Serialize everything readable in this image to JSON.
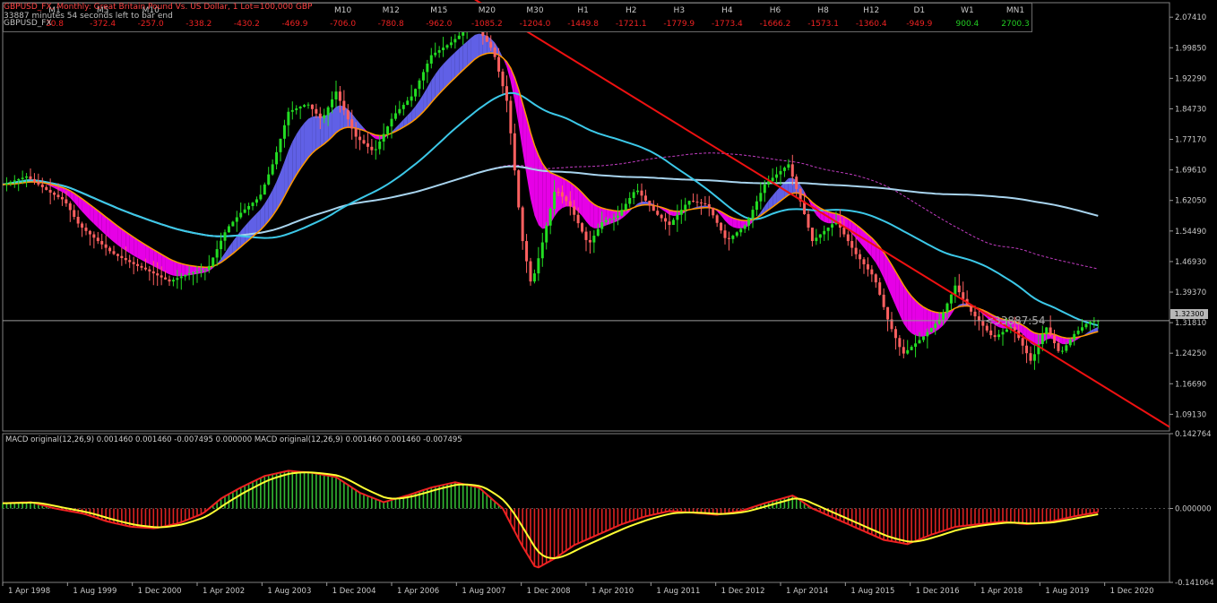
{
  "header": {
    "symbol_line": "GBPUSD_FX, Monthly:  Great Britain Pound Vs. US Dollar, 1 Lot=100,000 GBP",
    "timer_line": "33887 minutes 54 seconds left to bar end",
    "row_label": "GBPUSD_FX"
  },
  "timeframes": [
    {
      "label": "M1",
      "value": "30.8",
      "positive": false
    },
    {
      "label": "M5",
      "value": "-372.4",
      "positive": false
    },
    {
      "label": "M10",
      "value": "-257.0",
      "positive": false
    },
    {
      "label": "",
      "value": "-338.2",
      "positive": false
    },
    {
      "label": "",
      "value": "-430.2",
      "positive": false
    },
    {
      "label": "",
      "value": "-469.9",
      "positive": false
    },
    {
      "label": "M10",
      "value": "-706.0",
      "positive": false
    },
    {
      "label": "M12",
      "value": "-780.8",
      "positive": false
    },
    {
      "label": "M15",
      "value": "-962.0",
      "positive": false
    },
    {
      "label": "M20",
      "value": "-1085.2",
      "positive": false
    },
    {
      "label": "M30",
      "value": "-1204.0",
      "positive": false
    },
    {
      "label": "H1",
      "value": "-1449.8",
      "positive": false
    },
    {
      "label": "H2",
      "value": "-1721.1",
      "positive": false
    },
    {
      "label": "H3",
      "value": "-1779.9",
      "positive": false
    },
    {
      "label": "H4",
      "value": "-1773.4",
      "positive": false
    },
    {
      "label": "H6",
      "value": "-1666.2",
      "positive": false
    },
    {
      "label": "H8",
      "value": "-1573.1",
      "positive": false
    },
    {
      "label": "H12",
      "value": "-1360.4",
      "positive": false
    },
    {
      "label": "D1",
      "value": "-949.9",
      "positive": false
    },
    {
      "label": "W1",
      "value": "900.4",
      "positive": true
    },
    {
      "label": "MN1",
      "value": "2700.3",
      "positive": true
    }
  ],
  "current_price": "1.32300",
  "countdown": "<33887:54",
  "macd_label": "MACD original(12,26,9) 0.001460 0.001460 -0.007495 0.000000 MACD original(12,26,9) 0.001460 0.001460 -0.007495",
  "colors": {
    "background": "#000000",
    "up": "#22dd22",
    "down": "#ff6060",
    "ribbon_up": "#6a6aff",
    "ribbon_down": "#ff00ff",
    "ma_cyan": "#3cc8e8",
    "ma_lightblue": "#a8d4ee",
    "ma_purple": "#c23cc2",
    "ma_white": "#c8d0e0",
    "trendline": "#ee1111",
    "macd_signal": "#ffff33",
    "macd_line": "#ee2222"
  },
  "chart_data": [
    {
      "type": "line",
      "title": "GBPUSD_FX Monthly",
      "ylim": [
        1.05,
        2.11
      ],
      "y_ticks": [
        "2.07410",
        "1.99850",
        "1.92290",
        "1.84730",
        "1.77170",
        "1.69610",
        "1.62050",
        "1.54490",
        "1.46930",
        "1.39370",
        "1.31810",
        "1.24250",
        "1.16690",
        "1.09130"
      ],
      "x_labels": [
        "1 Apr 1998",
        "1 Aug 1999",
        "1 Dec 2000",
        "1 Apr 2002",
        "1 Aug 2003",
        "1 Dec 2004",
        "1 Apr 2006",
        "1 Aug 2007",
        "1 Dec 2008",
        "1 Apr 2010",
        "1 Aug 2011",
        "1 Dec 2012",
        "1 Apr 2014",
        "1 Aug 2015",
        "1 Dec 2016",
        "1 Apr 2018",
        "1 Aug 2019",
        "1 Dec 2020"
      ],
      "x_range": [
        1998.0,
        2022.5
      ],
      "series": [
        {
          "name": "close",
          "points": [
            [
              1998.0,
              1.66
            ],
            [
              1998.5,
              1.68
            ],
            [
              1999.0,
              1.64
            ],
            [
              1999.3,
              1.62
            ],
            [
              1999.6,
              1.56
            ],
            [
              2000.0,
              1.52
            ],
            [
              2000.3,
              1.49
            ],
            [
              2000.8,
              1.46
            ],
            [
              2001.0,
              1.45
            ],
            [
              2001.5,
              1.42
            ],
            [
              2001.9,
              1.44
            ],
            [
              2002.3,
              1.45
            ],
            [
              2002.7,
              1.55
            ],
            [
              2003.0,
              1.59
            ],
            [
              2003.4,
              1.63
            ],
            [
              2003.7,
              1.72
            ],
            [
              2004.0,
              1.84
            ],
            [
              2004.4,
              1.86
            ],
            [
              2004.7,
              1.82
            ],
            [
              2005.0,
              1.89
            ],
            [
              2005.4,
              1.78
            ],
            [
              2005.8,
              1.74
            ],
            [
              2006.2,
              1.83
            ],
            [
              2006.6,
              1.88
            ],
            [
              2007.0,
              1.98
            ],
            [
              2007.4,
              2.01
            ],
            [
              2007.9,
              2.06
            ],
            [
              2008.3,
              1.99
            ],
            [
              2008.6,
              1.86
            ],
            [
              2008.9,
              1.53
            ],
            [
              2009.1,
              1.41
            ],
            [
              2009.3,
              1.5
            ],
            [
              2009.6,
              1.65
            ],
            [
              2009.9,
              1.61
            ],
            [
              2010.3,
              1.51
            ],
            [
              2010.6,
              1.57
            ],
            [
              2010.9,
              1.58
            ],
            [
              2011.3,
              1.65
            ],
            [
              2011.7,
              1.59
            ],
            [
              2012.0,
              1.56
            ],
            [
              2012.4,
              1.62
            ],
            [
              2012.8,
              1.61
            ],
            [
              2013.2,
              1.52
            ],
            [
              2013.6,
              1.56
            ],
            [
              2014.0,
              1.66
            ],
            [
              2014.5,
              1.71
            ],
            [
              2014.8,
              1.6
            ],
            [
              2015.0,
              1.52
            ],
            [
              2015.5,
              1.57
            ],
            [
              2015.9,
              1.49
            ],
            [
              2016.3,
              1.43
            ],
            [
              2016.6,
              1.32
            ],
            [
              2016.9,
              1.24
            ],
            [
              2017.3,
              1.28
            ],
            [
              2017.7,
              1.33
            ],
            [
              2018.0,
              1.41
            ],
            [
              2018.3,
              1.35
            ],
            [
              2018.8,
              1.28
            ],
            [
              2019.2,
              1.31
            ],
            [
              2019.6,
              1.22
            ],
            [
              2019.9,
              1.31
            ],
            [
              2020.2,
              1.24
            ],
            [
              2020.5,
              1.29
            ],
            [
              2020.8,
              1.32
            ],
            [
              2021.0,
              1.323
            ]
          ]
        },
        {
          "name": "trendline",
          "points": [
            [
              2007.75,
              2.13
            ],
            [
              2022.5,
              1.06
            ]
          ]
        }
      ]
    },
    {
      "type": "bar",
      "title": "MACD original(12,26,9)",
      "ylim": [
        -0.141064,
        0.142764
      ],
      "y_ticks": [
        "0.142764",
        "0.000000",
        "-0.141064"
      ],
      "x_range": [
        1998.0,
        2022.5
      ],
      "series": [
        {
          "name": "histogram",
          "points": [
            [
              1998.0,
              0.01
            ],
            [
              1998.6,
              0.012
            ],
            [
              1999.1,
              0.0
            ],
            [
              1999.7,
              -0.01
            ],
            [
              2000.2,
              -0.025
            ],
            [
              2000.7,
              -0.035
            ],
            [
              2001.2,
              -0.038
            ],
            [
              2001.7,
              -0.028
            ],
            [
              2002.2,
              -0.01
            ],
            [
              2002.6,
              0.02
            ],
            [
              2003.0,
              0.04
            ],
            [
              2003.5,
              0.062
            ],
            [
              2004.0,
              0.072
            ],
            [
              2004.5,
              0.068
            ],
            [
              2005.0,
              0.06
            ],
            [
              2005.5,
              0.03
            ],
            [
              2006.0,
              0.012
            ],
            [
              2006.5,
              0.025
            ],
            [
              2007.0,
              0.04
            ],
            [
              2007.5,
              0.05
            ],
            [
              2008.0,
              0.04
            ],
            [
              2008.5,
              0.0
            ],
            [
              2008.9,
              -0.07
            ],
            [
              2009.2,
              -0.115
            ],
            [
              2009.6,
              -0.095
            ],
            [
              2010.0,
              -0.07
            ],
            [
              2010.5,
              -0.05
            ],
            [
              2011.0,
              -0.03
            ],
            [
              2011.5,
              -0.015
            ],
            [
              2012.0,
              -0.005
            ],
            [
              2012.5,
              -0.008
            ],
            [
              2013.0,
              -0.012
            ],
            [
              2013.5,
              -0.005
            ],
            [
              2014.0,
              0.01
            ],
            [
              2014.6,
              0.025
            ],
            [
              2015.0,
              0.0
            ],
            [
              2015.5,
              -0.02
            ],
            [
              2016.0,
              -0.04
            ],
            [
              2016.5,
              -0.06
            ],
            [
              2017.0,
              -0.068
            ],
            [
              2017.5,
              -0.05
            ],
            [
              2018.0,
              -0.035
            ],
            [
              2018.5,
              -0.03
            ],
            [
              2019.0,
              -0.025
            ],
            [
              2019.5,
              -0.03
            ],
            [
              2020.0,
              -0.025
            ],
            [
              2020.5,
              -0.015
            ],
            [
              2021.0,
              -0.007
            ]
          ]
        }
      ]
    }
  ]
}
